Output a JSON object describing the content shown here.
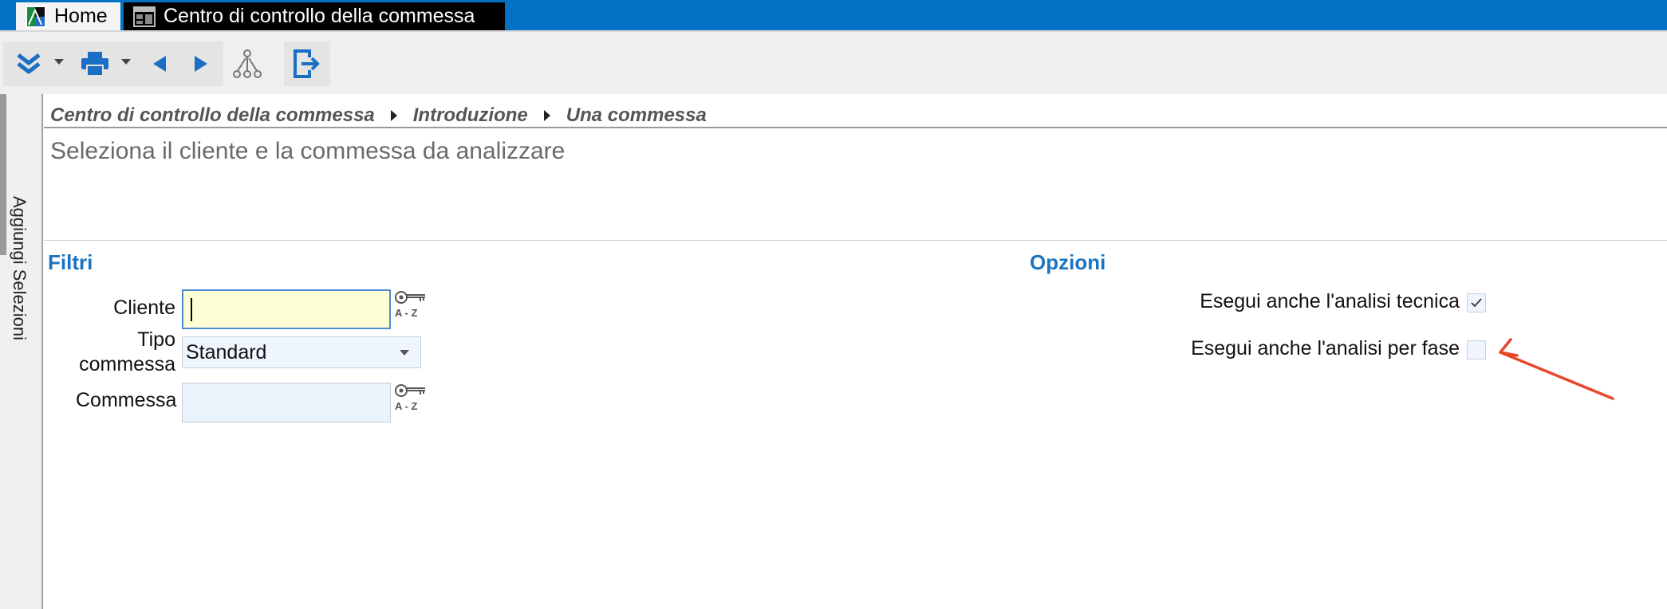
{
  "tabs": {
    "home_label": "Home",
    "active_label": "Centro di controllo della commessa"
  },
  "toolbar": {
    "buttons": [
      "expand-menu",
      "print",
      "previous",
      "next",
      "hierarchy",
      "exit"
    ]
  },
  "sidebar": {
    "vertical_label": "Aggiungi Selezioni"
  },
  "breadcrumb": {
    "items": [
      "Centro di controllo della commessa",
      "Introduzione",
      "Una commessa"
    ]
  },
  "intro_text": "Seleziona il cliente e la commessa da analizzare",
  "filtri": {
    "title": "Filtri",
    "cliente_label": "Cliente",
    "cliente_value": "",
    "tipo_label_line1": "Tipo",
    "tipo_label_line2": "commessa",
    "tipo_value": "Standard",
    "commessa_label": "Commessa",
    "commessa_value": "",
    "lookup_text": "A - Z"
  },
  "opzioni": {
    "title": "Opzioni",
    "tecnica_label": "Esegui anche l'analisi tecnica",
    "tecnica_checked": true,
    "fase_label": "Esegui anche l'analisi per fase",
    "fase_checked": false
  },
  "colors": {
    "title_bar": "#0372c4",
    "section_title": "#1a74c0",
    "annotation_arrow": "#e8472a",
    "active_field": "#ffffd5"
  }
}
